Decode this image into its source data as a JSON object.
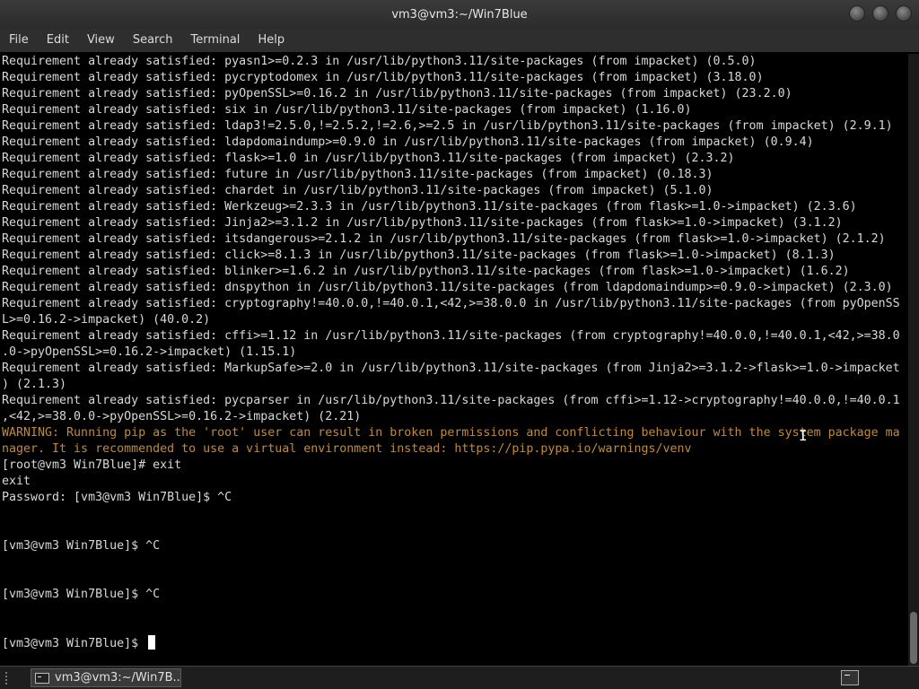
{
  "window": {
    "title": "vm3@vm3:~/Win7Blue"
  },
  "menu": [
    "File",
    "Edit",
    "View",
    "Search",
    "Terminal",
    "Help"
  ],
  "terminal_lines": [
    {
      "text": "Requirement already satisfied: pyasn1>=0.2.3 in /usr/lib/python3.11/site-packages (from impacket) (0.5.0)",
      "style": "normal"
    },
    {
      "text": "Requirement already satisfied: pycryptodomex in /usr/lib/python3.11/site-packages (from impacket) (3.18.0)",
      "style": "normal"
    },
    {
      "text": "Requirement already satisfied: pyOpenSSL>=0.16.2 in /usr/lib/python3.11/site-packages (from impacket) (23.2.0)",
      "style": "normal"
    },
    {
      "text": "Requirement already satisfied: six in /usr/lib/python3.11/site-packages (from impacket) (1.16.0)",
      "style": "normal"
    },
    {
      "text": "Requirement already satisfied: ldap3!=2.5.0,!=2.5.2,!=2.6,>=2.5 in /usr/lib/python3.11/site-packages (from impacket) (2.9.1)",
      "style": "normal"
    },
    {
      "text": "Requirement already satisfied: ldapdomaindump>=0.9.0 in /usr/lib/python3.11/site-packages (from impacket) (0.9.4)",
      "style": "normal"
    },
    {
      "text": "Requirement already satisfied: flask>=1.0 in /usr/lib/python3.11/site-packages (from impacket) (2.3.2)",
      "style": "normal"
    },
    {
      "text": "Requirement already satisfied: future in /usr/lib/python3.11/site-packages (from impacket) (0.18.3)",
      "style": "normal"
    },
    {
      "text": "Requirement already satisfied: chardet in /usr/lib/python3.11/site-packages (from impacket) (5.1.0)",
      "style": "normal"
    },
    {
      "text": "Requirement already satisfied: Werkzeug>=2.3.3 in /usr/lib/python3.11/site-packages (from flask>=1.0->impacket) (2.3.6)",
      "style": "normal"
    },
    {
      "text": "Requirement already satisfied: Jinja2>=3.1.2 in /usr/lib/python3.11/site-packages (from flask>=1.0->impacket) (3.1.2)",
      "style": "normal"
    },
    {
      "text": "Requirement already satisfied: itsdangerous>=2.1.2 in /usr/lib/python3.11/site-packages (from flask>=1.0->impacket) (2.1.2)",
      "style": "normal"
    },
    {
      "text": "Requirement already satisfied: click>=8.1.3 in /usr/lib/python3.11/site-packages (from flask>=1.0->impacket) (8.1.3)",
      "style": "normal"
    },
    {
      "text": "Requirement already satisfied: blinker>=1.6.2 in /usr/lib/python3.11/site-packages (from flask>=1.0->impacket) (1.6.2)",
      "style": "normal"
    },
    {
      "text": "Requirement already satisfied: dnspython in /usr/lib/python3.11/site-packages (from ldapdomaindump>=0.9.0->impacket) (2.3.0)",
      "style": "normal"
    },
    {
      "text": "Requirement already satisfied: cryptography!=40.0.0,!=40.0.1,<42,>=38.0.0 in /usr/lib/python3.11/site-packages (from pyOpenSS",
      "style": "normal"
    },
    {
      "text": "L>=0.16.2->impacket) (40.0.2)",
      "style": "normal"
    },
    {
      "text": "Requirement already satisfied: cffi>=1.12 in /usr/lib/python3.11/site-packages (from cryptography!=40.0.0,!=40.0.1,<42,>=38.0",
      "style": "normal"
    },
    {
      "text": ".0->pyOpenSSL>=0.16.2->impacket) (1.15.1)",
      "style": "normal"
    },
    {
      "text": "Requirement already satisfied: MarkupSafe>=2.0 in /usr/lib/python3.11/site-packages (from Jinja2>=3.1.2->flask>=1.0->impacket",
      "style": "normal"
    },
    {
      "text": ") (2.1.3)",
      "style": "normal"
    },
    {
      "text": "Requirement already satisfied: pycparser in /usr/lib/python3.11/site-packages (from cffi>=1.12->cryptography!=40.0.0,!=40.0.1",
      "style": "normal"
    },
    {
      "text": ",<42,>=38.0.0->pyOpenSSL>=0.16.2->impacket) (2.21)",
      "style": "normal"
    },
    {
      "text": "WARNING: Running pip as the 'root' user can result in broken permissions and conflicting behaviour with the system package ma",
      "style": "warn"
    },
    {
      "text": "nager. It is recommended to use a virtual environment instead: https://pip.pypa.io/warnings/venv",
      "style": "warn"
    },
    {
      "text": "[root@vm3 Win7Blue]# exit",
      "style": "normal"
    },
    {
      "text": "exit",
      "style": "normal"
    },
    {
      "text": "Password: [vm3@vm3 Win7Blue]$ ^C",
      "style": "normal"
    },
    {
      "text": "",
      "style": "normal"
    },
    {
      "text": "",
      "style": "normal"
    },
    {
      "text": "[vm3@vm3 Win7Blue]$ ^C",
      "style": "normal"
    },
    {
      "text": "",
      "style": "normal"
    },
    {
      "text": "",
      "style": "normal"
    },
    {
      "text": "[vm3@vm3 Win7Blue]$ ^C",
      "style": "normal"
    },
    {
      "text": "",
      "style": "normal"
    },
    {
      "text": "",
      "style": "normal"
    },
    {
      "text": "[vm3@vm3 Win7Blue]$ ",
      "style": "prompt-cursor"
    }
  ],
  "taskbar": {
    "task_label": "vm3@vm3:~/Win7B..."
  }
}
